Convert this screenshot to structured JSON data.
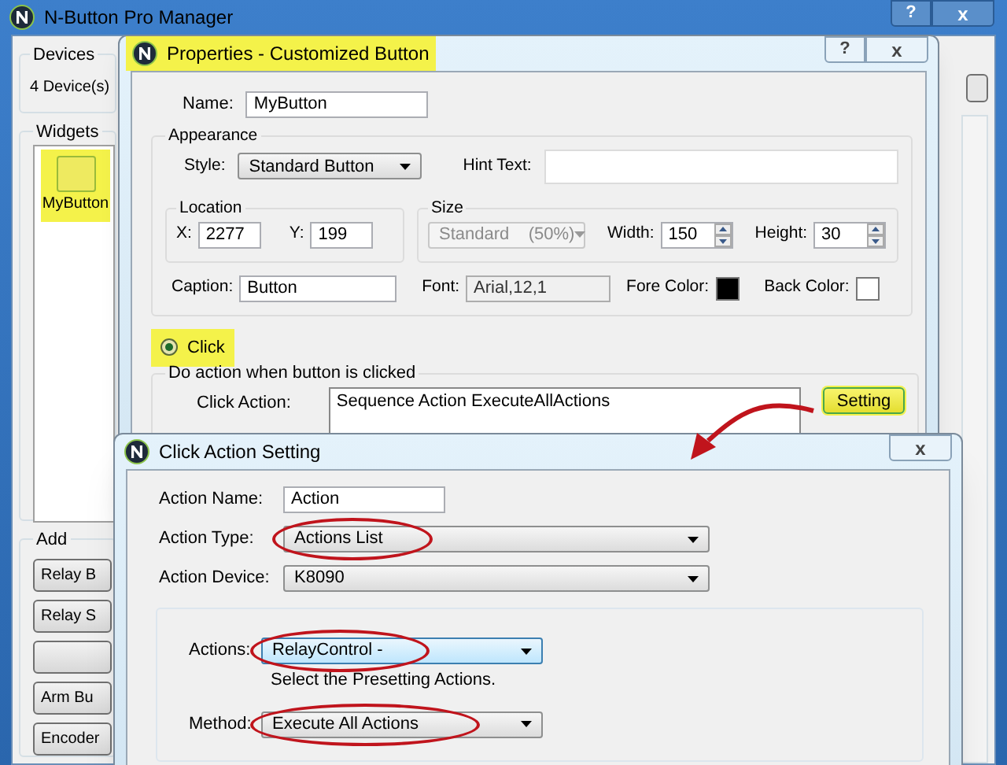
{
  "main_window": {
    "title": "N-Button Pro Manager",
    "help": "?",
    "close": "x",
    "devices": {
      "label": "Devices",
      "count": "4 Device(s)"
    },
    "widgets": {
      "label": "Widgets",
      "items": [
        {
          "label": "MyButton",
          "selected": true,
          "highlighted": true
        }
      ]
    },
    "add": {
      "label": "Add",
      "buttons": [
        "Relay B",
        "Relay S",
        "Arm Bu",
        "Encoder"
      ]
    }
  },
  "properties": {
    "title": "Properties - Customized Button",
    "highlighted": true,
    "help": "?",
    "close": "x",
    "name": {
      "label": "Name:",
      "value": "MyButton"
    },
    "appearance": {
      "label": "Appearance",
      "style": {
        "label": "Style:",
        "value": "Standard Button"
      },
      "hint": {
        "label": "Hint Text:"
      },
      "location": {
        "label": "Location",
        "x": {
          "label": "X:",
          "value": "2277"
        },
        "y": {
          "label": "Y:",
          "value": "199"
        }
      },
      "size": {
        "label": "Size",
        "preset": {
          "value": "Standard    (50%)",
          "disabled": true
        },
        "width": {
          "label": "Width:",
          "value": "150"
        },
        "height": {
          "label": "Height:",
          "value": "30"
        }
      },
      "caption": {
        "label": "Caption:",
        "value": "Button"
      },
      "font": {
        "label": "Font:",
        "value": "Arial,12,1"
      },
      "fore_color": {
        "label": "Fore Color:",
        "color": "#000000"
      },
      "back_color": {
        "label": "Back Color:",
        "color": "#ffffff"
      }
    },
    "click": {
      "label": "Click",
      "selected": true,
      "highlighted": true
    },
    "action_group": {
      "label": "Do action when button is clicked",
      "click_action": {
        "label": "Click Action:",
        "value": "Sequence Action ExecuteAllActions"
      },
      "setting_button": {
        "label": "Setting",
        "highlighted": true
      }
    }
  },
  "click_action_setting": {
    "title": "Click Action Setting",
    "close": "x",
    "action_name": {
      "label": "Action Name:",
      "value": "Action"
    },
    "action_type": {
      "label": "Action Type:",
      "value": "Actions List",
      "circled": true
    },
    "action_device": {
      "label": "Action Device:",
      "value": "K8090"
    },
    "actions": {
      "label": "Actions:",
      "value": "RelayControl -",
      "circled": true,
      "hint": "Select the Presetting Actions."
    },
    "method": {
      "label": "Method:",
      "value": "Execute All Actions",
      "circled": true
    }
  }
}
